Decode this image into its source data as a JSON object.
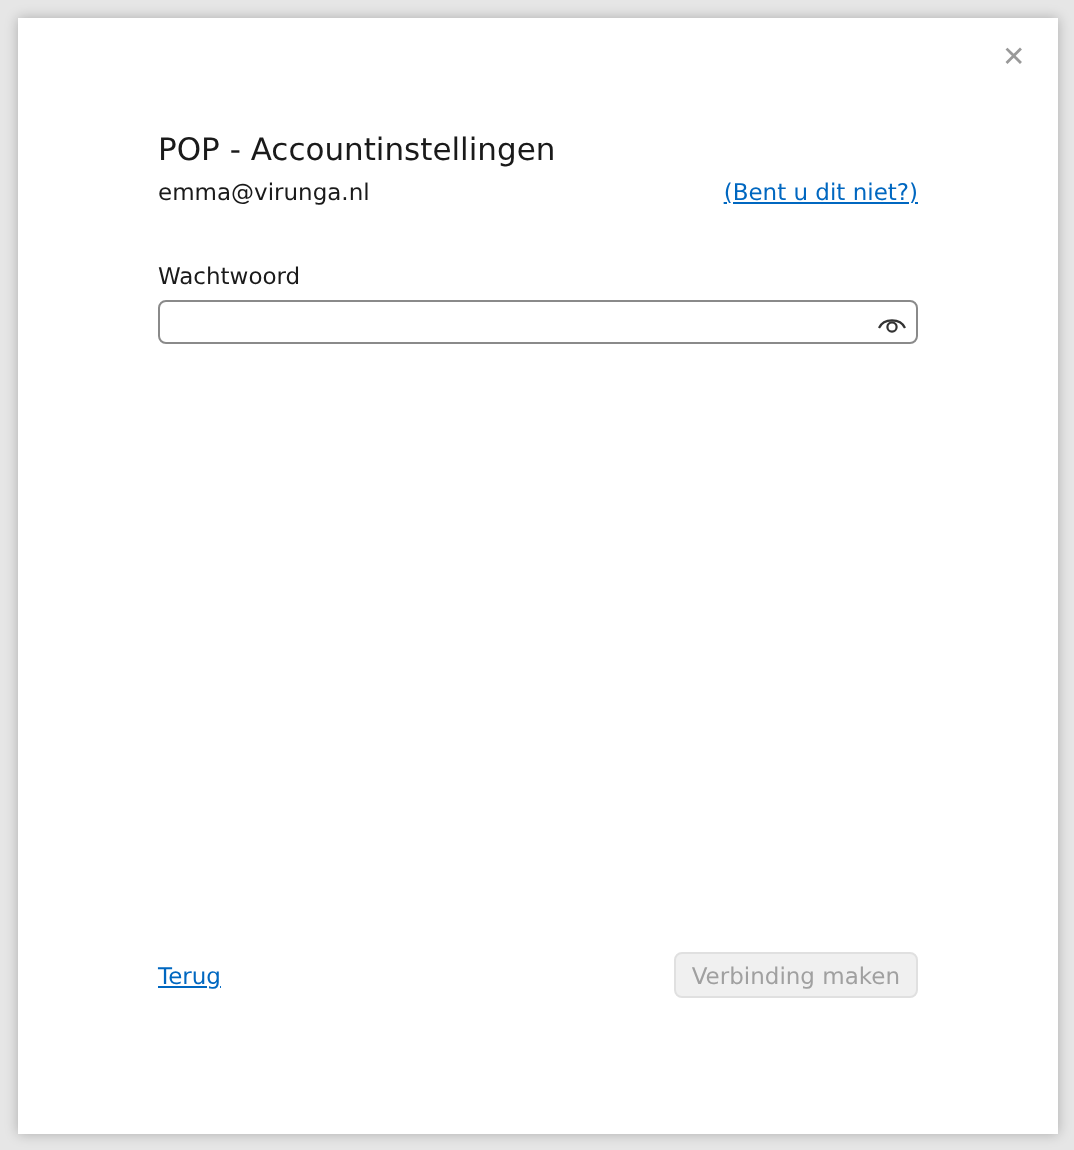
{
  "dialog": {
    "close_label": "✕",
    "title": "POP - Accountinstellingen",
    "email": "emma@virunga.nl",
    "not_you_link": "(Bent u dit niet?)"
  },
  "password": {
    "label": "Wachtwoord",
    "revealed": false
  },
  "footer": {
    "back_link": "Terug",
    "connect_button": {
      "label": "Verbinding maken",
      "disabled": true
    }
  }
}
